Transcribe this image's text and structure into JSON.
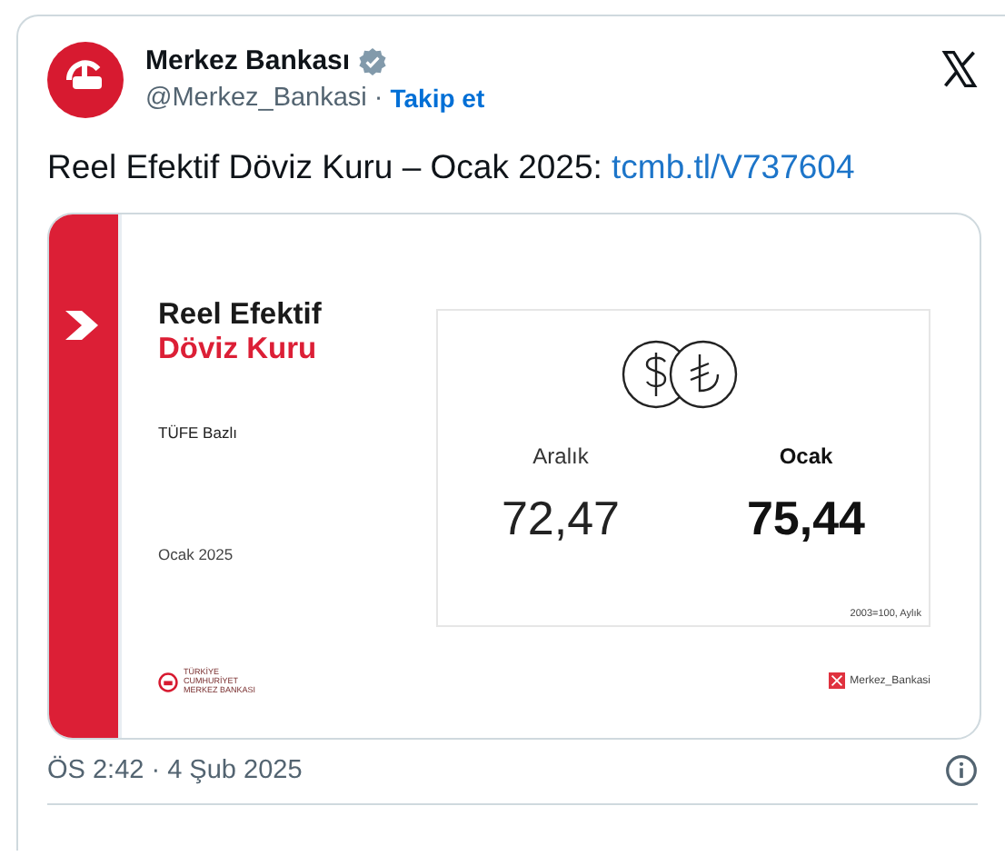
{
  "author": {
    "name": "Merkez Bankası",
    "verified": true,
    "handle": "@Merkez_Bankasi",
    "separator": "·",
    "follow": "Takip et"
  },
  "tweet": {
    "text": "Reel Efektif Döviz Kuru – Ocak 2025: ",
    "link": "tcmb.tl/V737604"
  },
  "media": {
    "title_line_1": "Reel Efektif",
    "title_line_2": "Döviz Kuru",
    "basis": "TÜFE Bazlı",
    "period": "Ocak 2025",
    "values": [
      {
        "label": "Aralık",
        "value": "72,47",
        "current": false
      },
      {
        "label": "Ocak",
        "value": "75,44",
        "current": true
      }
    ],
    "note": "2003=100, Aylık",
    "footer_logo_text": "TÜRKİYE CUMHURİYET MERKEZ BANKASI",
    "social_handle": "Merkez_Bankasi"
  },
  "timestamp": "ÖS 2:42 · 4 Şub 2025"
}
